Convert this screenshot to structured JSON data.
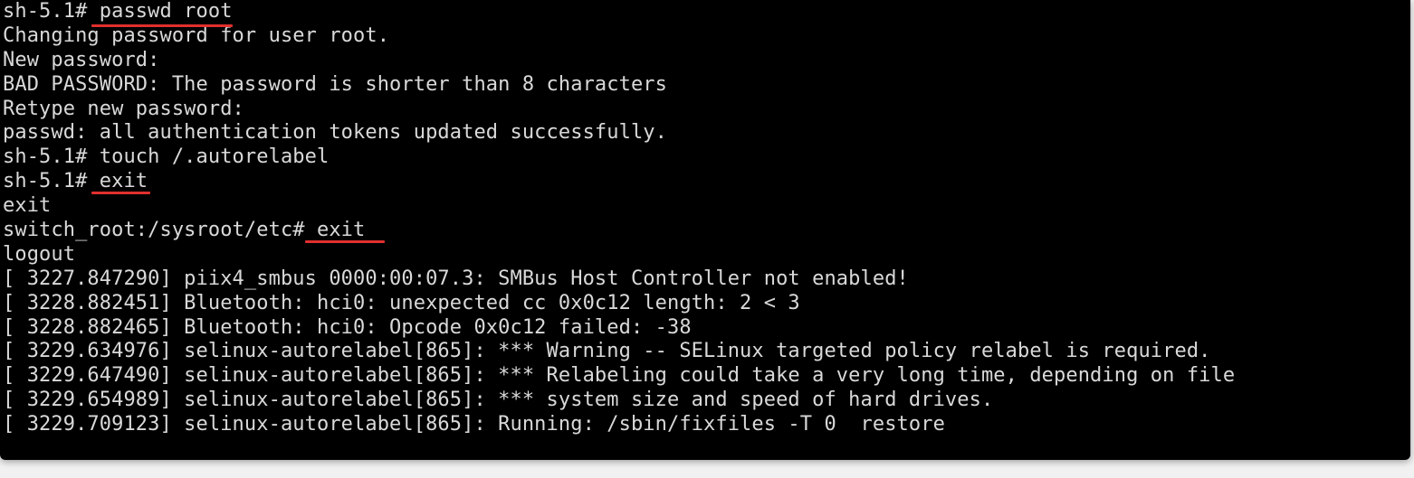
{
  "terminal": {
    "lines": [
      "sh-5.1# passwd root",
      "Changing password for user root.",
      "New password:",
      "BAD PASSWORD: The password is shorter than 8 characters",
      "Retype new password:",
      "passwd: all authentication tokens updated successfully.",
      "sh-5.1# touch /.autorelabel",
      "sh-5.1# exit",
      "exit",
      "switch_root:/sysroot/etc# exit",
      "logout",
      "[ 3227.847290] piix4_smbus 0000:00:07.3: SMBus Host Controller not enabled!",
      "[ 3228.882451] Bluetooth: hci0: unexpected cc 0x0c12 length: 2 < 3",
      "[ 3228.882465] Bluetooth: hci0: Opcode 0x0c12 failed: -38",
      "[ 3229.634976] selinux-autorelabel[865]: *** Warning -- SELinux targeted policy relabel is required.",
      "[ 3229.647490] selinux-autorelabel[865]: *** Relabeling could take a very long time, depending on file",
      "[ 3229.654989] selinux-autorelabel[865]: *** system size and speed of hard drives.",
      "[ 3229.709123] selinux-autorelabel[865]: Running: /sbin/fixfiles -T 0  restore"
    ]
  },
  "colors": {
    "background": "#000000",
    "text": "#d9d9d9",
    "annotation": "#e0302f"
  }
}
